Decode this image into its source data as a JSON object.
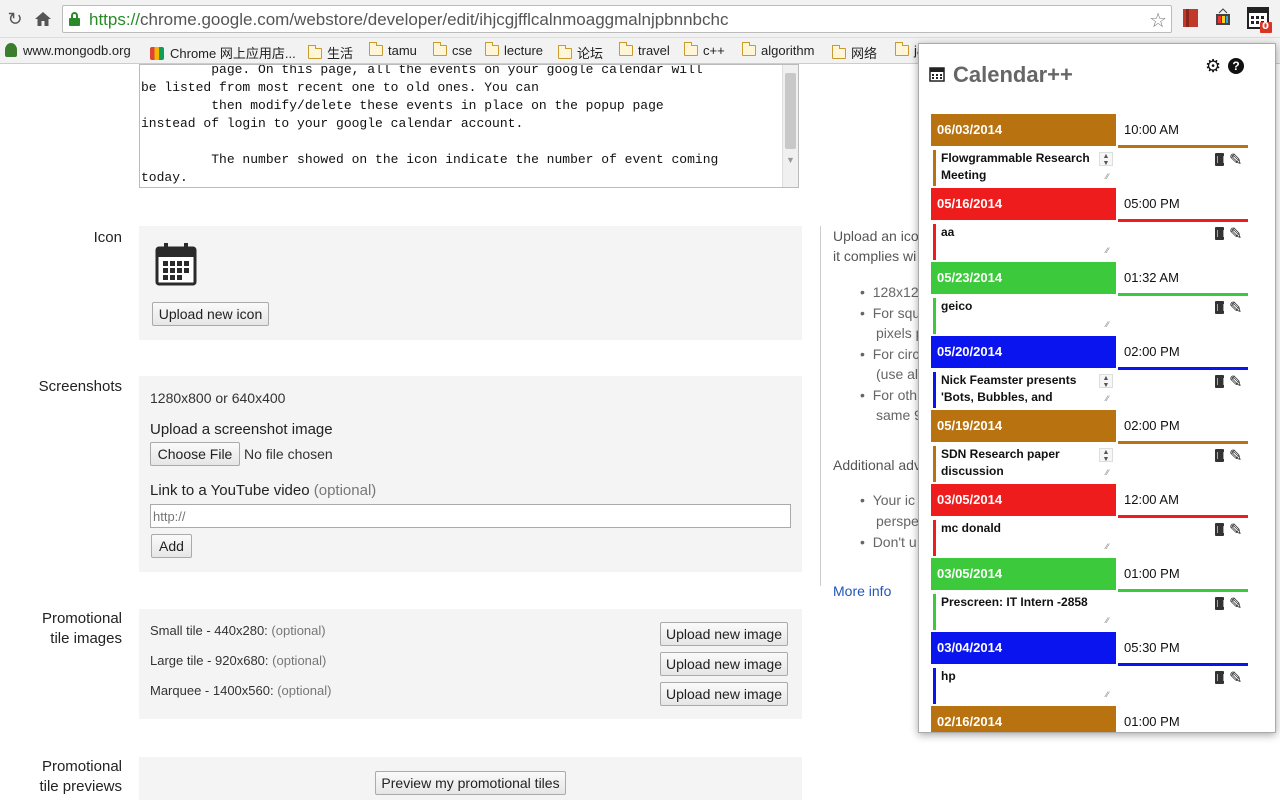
{
  "browser": {
    "url_scheme": "https://",
    "url_rest": "chrome.google.com/webstore/developer/edit/ihjcgjfflcalnmoaggmalnjpbnnbchc",
    "badge_count": "0"
  },
  "bookmarks": [
    {
      "label": "www.mongodb.org",
      "type": "site"
    },
    {
      "label": "Chrome 网上应用店...",
      "type": "site"
    },
    {
      "label": "生活",
      "type": "folder"
    },
    {
      "label": "tamu",
      "type": "folder"
    },
    {
      "label": "cse",
      "type": "folder"
    },
    {
      "label": "lecture",
      "type": "folder"
    },
    {
      "label": "论坛",
      "type": "folder"
    },
    {
      "label": "travel",
      "type": "folder"
    },
    {
      "label": "c++",
      "type": "folder"
    },
    {
      "label": "algorithm",
      "type": "folder"
    },
    {
      "label": "网络",
      "type": "folder"
    },
    {
      "label": "ja",
      "type": "folder"
    }
  ],
  "description": {
    "text": "         page. On this page, all the events on your google calendar will\nbe listed from most recent one to old ones. You can\n         then modify/delete these events in place on the popup page\ninstead of login to your google calendar account.\n\n         The number showed on the icon indicate the number of event coming\ntoday."
  },
  "icon_section": {
    "label": "Icon",
    "upload_button": "Upload new icon"
  },
  "screenshots": {
    "label": "Screenshots",
    "size_hint": "1280x800 or 640x400",
    "upload_heading": "Upload a screenshot image",
    "choose_file": "Choose File",
    "no_file": "No file chosen",
    "youtube_heading": "Link to a YouTube video",
    "youtube_optional": "(optional)",
    "youtube_placeholder": "http://",
    "add_button": "Add"
  },
  "promo_tiles": {
    "label_line1": "Promotional",
    "label_line2": "tile images",
    "rows": [
      {
        "name": "Small tile - 440x280:",
        "optional": "(optional)",
        "button": "Upload new image"
      },
      {
        "name": "Large tile - 920x680:",
        "optional": "(optional)",
        "button": "Upload new image"
      },
      {
        "name": "Marquee - 1400x560:",
        "optional": "(optional)",
        "button": "Upload new image"
      }
    ]
  },
  "promo_previews": {
    "label_line1": "Promotional",
    "label_line2": "tile previews",
    "button": "Preview my promotional tiles"
  },
  "sidebar_help": {
    "line1": "Upload an ico",
    "line2": "it complies wi",
    "bullets": [
      "128x12",
      "For squ",
      "pixels p",
      "For circ",
      "(use alp",
      "For oth",
      "same 9"
    ],
    "additional": "Additional adv",
    "bullets2": [
      "Your ic",
      "perspe",
      "Don't u"
    ],
    "more_info": "More info"
  },
  "popup": {
    "title": "Calendar++",
    "events": [
      {
        "date": "06/03/2014",
        "time": "10:00 AM",
        "title": "Flowgrammable Research Meeting",
        "color": "#b8720f",
        "spinner": true
      },
      {
        "date": "05/16/2014",
        "time": "05:00 PM",
        "title": "aa",
        "color": "#ee1c1c",
        "spinner": false
      },
      {
        "date": "05/23/2014",
        "time": "01:32 AM",
        "title": "geico",
        "color": "#3cc93c",
        "spinner": false
      },
      {
        "date": "05/20/2014",
        "time": "02:00 PM",
        "title": "Nick Feamster presents 'Bots, Bubbles, and",
        "color": "#0a14ee",
        "spinner": true
      },
      {
        "date": "05/19/2014",
        "time": "02:00 PM",
        "title": "SDN Research paper discussion",
        "color": "#b8720f",
        "spinner": true
      },
      {
        "date": "03/05/2014",
        "time": "12:00 AM",
        "title": "mc donald",
        "color": "#ee1c1c",
        "spinner": false
      },
      {
        "date": "03/05/2014",
        "time": "01:00 PM",
        "title": "Prescreen: IT Intern -2858",
        "color": "#3cc93c",
        "spinner": false
      },
      {
        "date": "03/04/2014",
        "time": "05:30 PM",
        "title": "hp",
        "color": "#0a14ee",
        "spinner": false
      },
      {
        "date": "02/16/2014",
        "time": "01:00 PM",
        "title": "",
        "color": "#b8720f",
        "spinner": false
      }
    ]
  }
}
